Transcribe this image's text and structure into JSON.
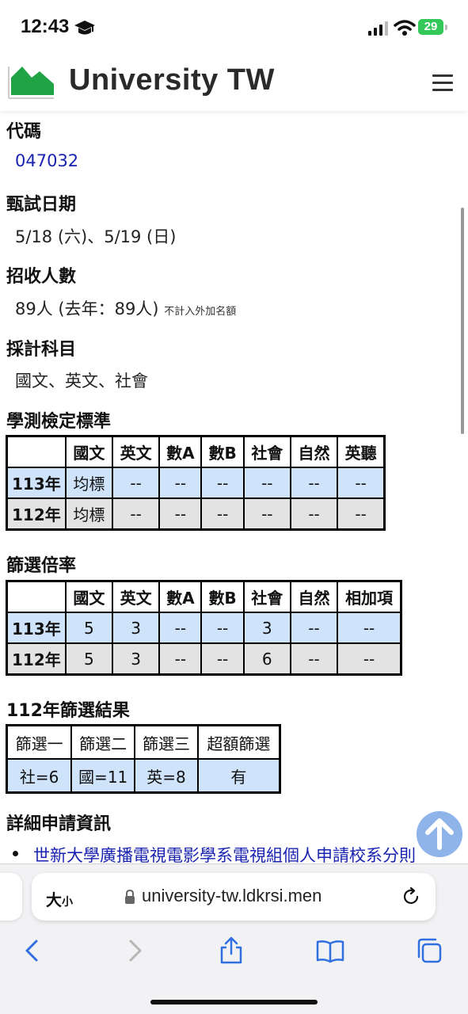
{
  "status_bar": {
    "time": "12:43",
    "battery": "29"
  },
  "header": {
    "site_title": "University TW"
  },
  "sections": {
    "code": {
      "heading": "代碼",
      "value": "047032"
    },
    "exam_date": {
      "heading": "甄試日期",
      "value": "5/18 (六)、5/19 (日)"
    },
    "enrollment": {
      "heading": "招收人數",
      "value": "89人 (去年：89人)",
      "note": "不計入外加名額"
    },
    "subjects": {
      "heading": "採計科目",
      "value": "國文、英文、社會"
    }
  },
  "gsat_standard": {
    "heading": "學測檢定標準",
    "columns": [
      "國文",
      "英文",
      "數A",
      "數B",
      "社會",
      "自然",
      "英聽"
    ],
    "rows": [
      {
        "year": "113年",
        "cells": [
          "均標",
          "--",
          "--",
          "--",
          "--",
          "--",
          "--"
        ]
      },
      {
        "year": "112年",
        "cells": [
          "均標",
          "--",
          "--",
          "--",
          "--",
          "--",
          "--"
        ]
      }
    ]
  },
  "screening_ratio": {
    "heading": "篩選倍率",
    "columns": [
      "國文",
      "英文",
      "數A",
      "數B",
      "社會",
      "自然",
      "相加項"
    ],
    "rows": [
      {
        "year": "113年",
        "cells": [
          "5",
          "3",
          "--",
          "--",
          "3",
          "--",
          "--"
        ]
      },
      {
        "year": "112年",
        "cells": [
          "5",
          "3",
          "--",
          "--",
          "6",
          "--",
          "--"
        ]
      }
    ]
  },
  "screening_result": {
    "heading": "112年篩選結果",
    "columns": [
      "篩選一",
      "篩選二",
      "篩選三",
      "超額篩選"
    ],
    "values": [
      "社=6",
      "國=11",
      "英=8",
      "有"
    ]
  },
  "details": {
    "heading": "詳細申請資訊",
    "link_text": "世新大學廣播電視電影學系電視組個人申請校系分則"
  },
  "browser": {
    "text_size_label": "大",
    "text_size_small": "小",
    "url": "university-tw.ldkrsi.men"
  },
  "colors": {
    "link": "#1a23b0",
    "row_current": "#cfe3fb",
    "row_previous": "#e3e3e3",
    "logo_green": "#1fa345"
  }
}
